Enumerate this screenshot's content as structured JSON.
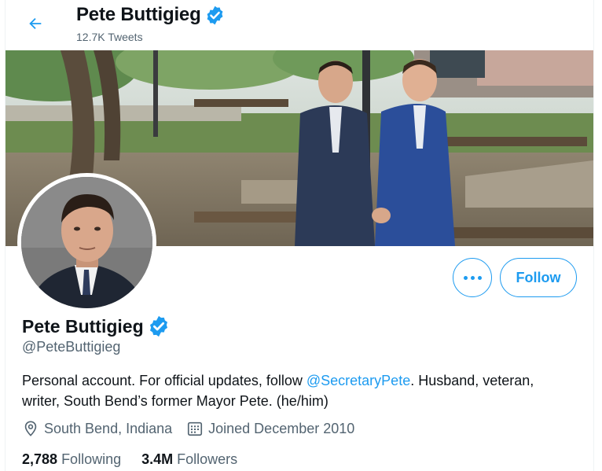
{
  "header": {
    "back_icon": "arrow-left-icon",
    "name": "Pete Buttigieg",
    "verified_icon": "verified-badge-icon",
    "tweet_count": "12.7K Tweets"
  },
  "profile": {
    "name": "Pete Buttigieg",
    "handle": "@PeteButtigieg",
    "bio_before": "Personal account. For official updates, follow ",
    "bio_mention": "@SecretaryPete",
    "bio_after": ". Husband, veteran, writer, South Bend’s former Mayor Pete. (he/him)",
    "location_icon": "location-pin-icon",
    "location": "South Bend, Indiana",
    "joined_icon": "calendar-icon",
    "joined": "Joined December 2010"
  },
  "actions": {
    "more_icon": "more-dots-icon",
    "follow_label": "Follow"
  },
  "stats": {
    "following_count": "2,788",
    "following_label": "Following",
    "followers_count": "3.4M",
    "followers_label": "Followers"
  },
  "colors": {
    "accent": "#1d9bf0",
    "text_primary": "#0f1419",
    "text_secondary": "#536471"
  }
}
